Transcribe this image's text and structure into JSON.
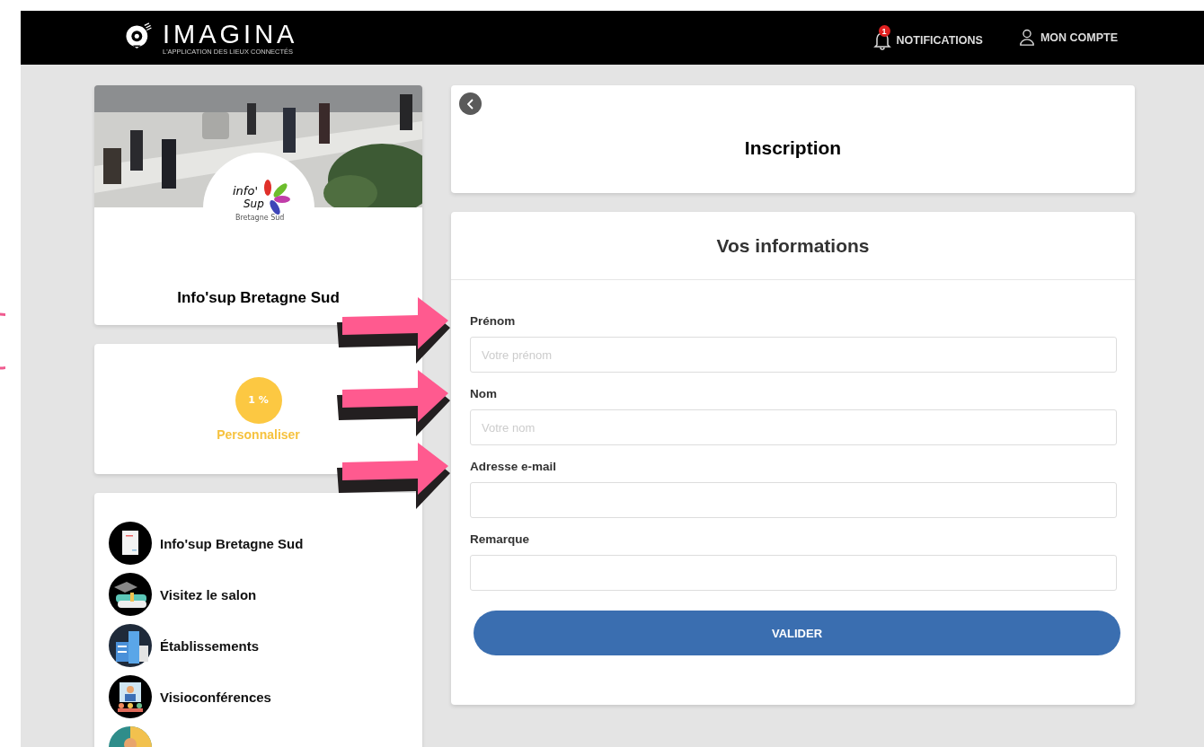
{
  "header": {
    "logo": {
      "name": "IMAGINA",
      "tagline": "L'APPLICATION DES LIEUX CONNECTÉS"
    },
    "nav": [
      {
        "kind": "bell",
        "label": "NOTIFICATIONS",
        "badge": "1"
      },
      {
        "kind": "user",
        "label": "MON COMPTE"
      }
    ]
  },
  "profile": {
    "photo": {
      "kind": "picture"
    },
    "logo_text": [
      "info'",
      "Sup",
      "Bretagne Sud"
    ],
    "name": "Info'sup Bretagne Sud"
  },
  "progress": {
    "value": "1 %",
    "action": "Personnaliser"
  },
  "menu": [
    {
      "kind": "document",
      "label": "Info'sup Bretagne Sud"
    },
    {
      "kind": "graduation",
      "label": "Visitez le salon"
    },
    {
      "kind": "buildings",
      "label": "Établissements"
    },
    {
      "kind": "video",
      "label": "Visioconférences"
    },
    {
      "kind": "meeting"
    }
  ],
  "page": {
    "title": "Inscription"
  },
  "form": {
    "title": "Vos informations",
    "fields": [
      {
        "label": "Prénom",
        "placeholder": "Votre prénom",
        "annotated": true
      },
      {
        "label": "Nom",
        "placeholder": "Votre nom",
        "annotated": true
      },
      {
        "label": "Adresse e-mail",
        "annotated": true
      },
      {
        "label": "Remarque",
        "annotated": false
      }
    ],
    "submit": "VALIDER"
  }
}
